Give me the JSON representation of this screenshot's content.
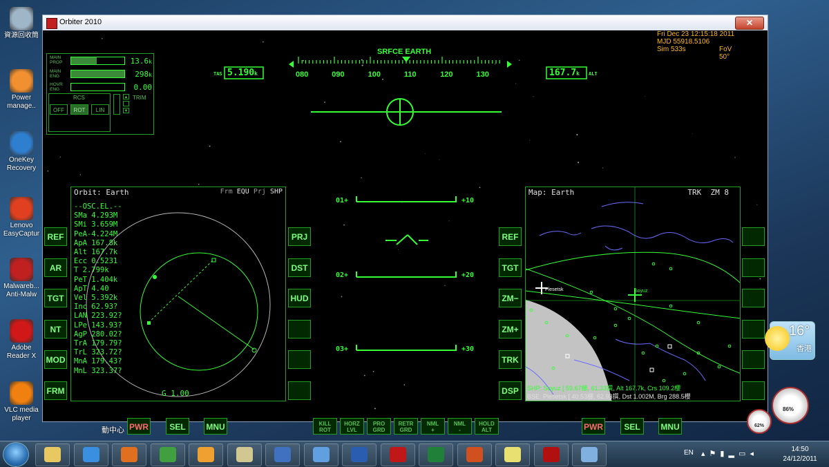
{
  "desktop": {
    "icons": [
      {
        "label": "資源回收筒",
        "color": "#9fb6c8"
      },
      {
        "label": "Power manage..",
        "color": "#f09030"
      },
      {
        "label": "OneKey Recovery",
        "color": "#2e7fd0"
      },
      {
        "label": "Lenovo EasyCaptur",
        "color": "#e04020"
      },
      {
        "label": "Malwareb... Anti-Malw",
        "color": "#c02020"
      },
      {
        "label": "Adobe Reader X",
        "color": "#d01818"
      },
      {
        "label": "VLC media player",
        "color": "#f08010"
      }
    ],
    "partial_label": "動中心"
  },
  "window": {
    "title": "Orbiter 2010",
    "close_label": "✕"
  },
  "hud": {
    "surface_label": "SRFCE EARTH",
    "tas_label": "TAS",
    "tas_value": "5.190",
    "tas_unit": "k",
    "alt_value": "167.7",
    "alt_unit": "k",
    "alt_label": "ALT",
    "heading_ticks": [
      "080",
      "090",
      "100",
      "110",
      "120",
      "130"
    ],
    "pitch_ladder": [
      {
        "left": "01+",
        "right": "+10"
      },
      {
        "left": "02+",
        "right": "+20"
      },
      {
        "left": "03+",
        "right": "+30"
      }
    ]
  },
  "info": {
    "date": "Fri Dec 23 12:15:18 2011",
    "mjd": "MJD 55918.5106",
    "sim": "Sim  533s",
    "fov": "FoV  50°"
  },
  "engine_panel": {
    "main_prop_label": "MAIN\nPROP",
    "main_prop_value": "13.6",
    "main_prop_unit": "k",
    "main_prop_level": 0.48,
    "main_eng_label": "MAIN\nENG",
    "main_eng_value": "298",
    "main_eng_unit": "k",
    "main_eng_level": 1.0,
    "hovr_eng_label": "HOVR\nENG",
    "hovr_eng_value": "0.00",
    "hovr_eng_level": 0.0,
    "rcs_label": "RCS",
    "rcs_off": "OFF",
    "rcs_rot": "ROT",
    "rcs_lin": "LIN",
    "trim_label": "TRIM"
  },
  "orbit_mfd": {
    "title": "Orbit: Earth",
    "frm_label": "Frm",
    "frm_value": "EQU",
    "prj_label": "Prj",
    "prj_value": "SHP",
    "header": "--OSC.EL.--",
    "elements": [
      "SMa 4.293M",
      "SMi 3.659M",
      "PeA-4.224M",
      "ApA 167.8k",
      "Alt 167.7k",
      "Ecc 0.5231",
      "T   2.799k",
      "PeT 1.404k",
      "ApT 4.40",
      "Vel 5.392k",
      "Inc  62.93?",
      "LAN 223.92?",
      "LPe 143.93?",
      "AgP 280.02?",
      "TrA 179.79?",
      "TrL 323.72?",
      "MnA 179.43?",
      "MnL 323.37?"
    ],
    "g_value": "G 1.00"
  },
  "left_mfd_buttons_left": [
    "REF",
    "AR",
    "TGT",
    "NT",
    "MOD",
    "FRM"
  ],
  "left_mfd_buttons_right": [
    "PRJ",
    "DST",
    "HUD",
    "",
    "",
    ""
  ],
  "left_mfd_bottom": {
    "pwr": "PWR",
    "sel": "SEL",
    "mnu": "MNU"
  },
  "map_mfd": {
    "title": "Map: Earth",
    "trk": "TRK",
    "zoom": "ZM 8",
    "ship_label": "Soyuz",
    "base_label": "Plesetsk",
    "shp_line": "SHP:  Soyuz [ 59.67櫛, 61.33撰, Alt 167.7k, Crs 109.2櫻",
    "bse_line": "BSE:  Plesetsk [ 40.53櫛, 62.93撰, Dst 1.002M, Brg 288.5櫻"
  },
  "right_mfd_buttons_left": [
    "REF",
    "TGT",
    "ZM−",
    "ZM+",
    "TRK",
    "DSP"
  ],
  "right_mfd_buttons_right": [
    "",
    "",
    "",
    "",
    "",
    ""
  ],
  "right_mfd_bottom": {
    "pwr": "PWR",
    "sel": "SEL",
    "mnu": "MNU"
  },
  "nav_buttons": [
    {
      "l1": "KILL",
      "l2": "ROT"
    },
    {
      "l1": "HORZ",
      "l2": "LVL"
    },
    {
      "l1": "PRO",
      "l2": "GRD"
    },
    {
      "l1": "RETR",
      "l2": "GRD"
    },
    {
      "l1": "NML",
      "l2": "+"
    },
    {
      "l1": "NML",
      "l2": "-"
    },
    {
      "l1": "HOLD",
      "l2": "ALT"
    }
  ],
  "weather": {
    "temp": "16°",
    "city": "香港"
  },
  "gadget": {
    "cpu": "86%",
    "mem": "62%"
  },
  "taskbar": {
    "apps": [
      {
        "name": "explorer",
        "color": "#e8c860"
      },
      {
        "name": "internet-explorer",
        "color": "#3a8fe0"
      },
      {
        "name": "firefox",
        "color": "#e07020"
      },
      {
        "name": "chrome",
        "color": "#40a040"
      },
      {
        "name": "media-player",
        "color": "#f0a030"
      },
      {
        "name": "folder-tool",
        "color": "#d0c890"
      },
      {
        "name": "thunderbird",
        "color": "#4070c0"
      },
      {
        "name": "messenger",
        "color": "#60a0e0"
      },
      {
        "name": "word",
        "color": "#2a5cb0"
      },
      {
        "name": "acrobat",
        "color": "#c01818"
      },
      {
        "name": "excel",
        "color": "#20803a"
      },
      {
        "name": "powerpoint",
        "color": "#d05020"
      },
      {
        "name": "sticky-notes",
        "color": "#e8e070"
      },
      {
        "name": "orbiter",
        "color": "#b01010"
      },
      {
        "name": "paint",
        "color": "#80b0e0"
      }
    ],
    "lang": "EN",
    "time": "14:50",
    "date": "24/12/2011"
  }
}
